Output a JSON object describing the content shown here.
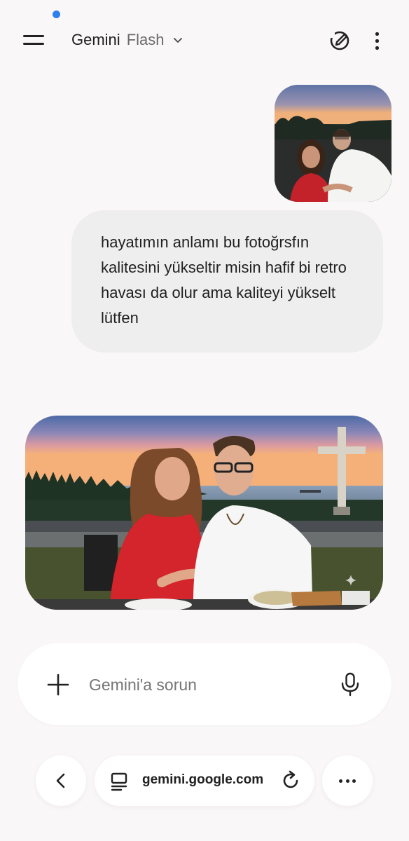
{
  "header": {
    "app_title": "Gemini",
    "model_name": "Flash",
    "menu_icon": "hamburger-menu-icon",
    "model_dropdown_icon": "chevron-down-icon",
    "new_chat_icon": "edit-pen-icon",
    "more_icon": "more-vert-icon"
  },
  "conversation": {
    "user_image_alt": "couple-photo-thumbnail",
    "user_message": "hayatımın anlamı bu fotoğrsfın kalitesini yükseltir misin hafif bi retro havası da olur ama kaliteyi yükselt lütfen",
    "result_image_alt": "enhanced-couple-photo",
    "result_sparkle_icon": "sparkle-icon"
  },
  "input": {
    "placeholder": "Gemini'a sorun",
    "add_icon": "plus-icon",
    "mic_icon": "microphone-icon"
  },
  "browser": {
    "url": "gemini.google.com",
    "back_icon": "chevron-left-icon",
    "tabs_icon": "tabs-icon",
    "reload_icon": "reload-icon",
    "menu_icon": "more-horiz-icon"
  },
  "colors": {
    "background": "#faf7f8",
    "bubble": "#efeeef",
    "accent_dot": "#2f80ed"
  }
}
